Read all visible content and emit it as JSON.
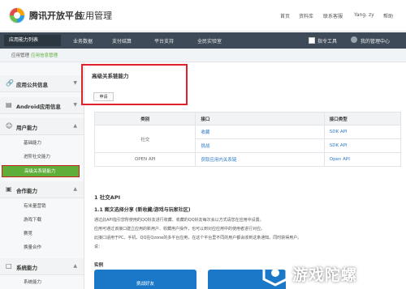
{
  "header": {
    "brand": "腾讯开放平台",
    "section": "应用管理",
    "links": [
      "首页",
      "资料库",
      "联系客服",
      "Yang. zy",
      "帮助"
    ]
  },
  "nav": {
    "items": [
      "应用能力列表",
      "业务数据",
      "支付结算",
      "平台支持",
      "全民实验室"
    ],
    "right_items": [
      "指令工具",
      "我的管理中心"
    ]
  },
  "breadcrumb": [
    "应用管理",
    "应用信息管理"
  ],
  "sidebar": {
    "groups": [
      {
        "label": "应用公共信息"
      },
      {
        "label": "Android应用信息"
      },
      {
        "label": "用户能力",
        "items": [
          "基础能力",
          "进阶社交能力",
          "高级关系链能力"
        ]
      },
      {
        "label": "合作能力",
        "items": [
          "有米量营销",
          "游戏下载",
          "赛竞",
          "换量合作"
        ]
      },
      {
        "label": "系统能力",
        "items": [
          "系统能力"
        ]
      }
    ],
    "selected_item": "高级关系链能力"
  },
  "panel": {
    "title": "高级关系链能力",
    "button": "申请"
  },
  "table": {
    "headers": [
      "类别",
      "接口",
      "接口类型"
    ],
    "rows": [
      {
        "category": "社交",
        "interface": "收藏",
        "type": "SDK API"
      },
      {
        "category": "",
        "interface": "挑战",
        "type": "SDK API"
      },
      {
        "category": "OPEN API",
        "interface": "获取应用内关系链",
        "type": "Open API"
      }
    ]
  },
  "doc": {
    "section1": "1 社交API",
    "section11": "1.1 图文选择分享 (新收藏/游戏与玩家社区)",
    "paragraphs": [
      "通过此API指引您所使用的QQ好友进行收藏、收藏的QQ好友每次会以方式请您在应用中设置。",
      "应用可通过该接口建立应用的新用户、收藏用户操作，也可以到对应应用中的使用者进行对应。",
      "此接口适用于PC、手机、QQ在Qzone的多平台应用，在这个平台里不同的用户都会收到这条通知。同时获得用户。",
      "说："
    ],
    "example": "实例",
    "phone_title": "挑战好友"
  },
  "watermark": "游戏陀螺",
  "colors": {
    "nav_bg": "#3e4a57",
    "accent_green": "#5fae3a",
    "highlight_red": "#e0212a",
    "link_blue": "#2e79c7"
  }
}
